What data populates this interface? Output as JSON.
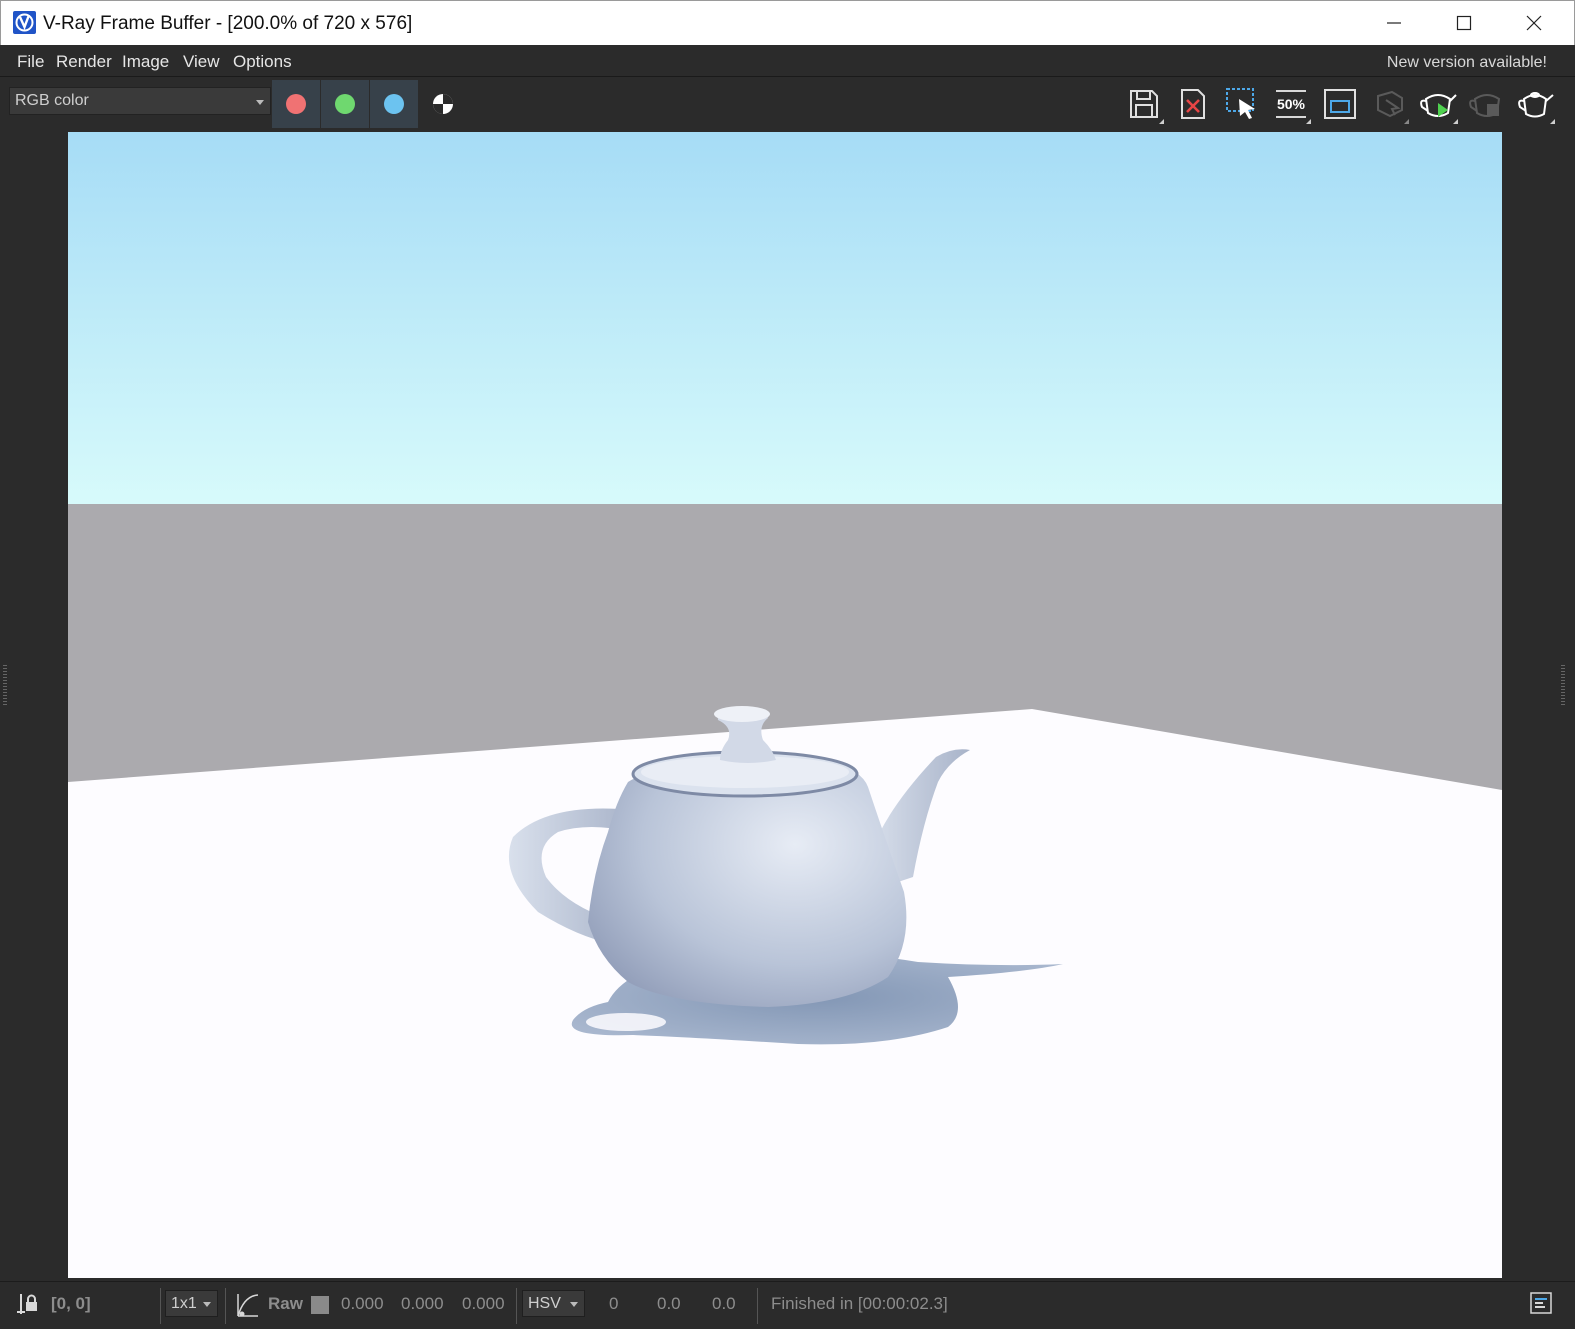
{
  "window": {
    "title": "V-Ray Frame Buffer - [200.0% of 720 x 576]",
    "controls": [
      "minimize",
      "maximize",
      "close"
    ]
  },
  "menu": {
    "items": [
      "File",
      "Render",
      "Image",
      "View",
      "Options"
    ],
    "notice": "New version available!"
  },
  "toolbar": {
    "channel": "RGB color",
    "channel_buttons": [
      {
        "name": "red-channel",
        "color": "#f07273"
      },
      {
        "name": "green-channel",
        "color": "#6fd86f"
      },
      {
        "name": "blue-channel",
        "color": "#6cc3f0"
      }
    ],
    "zoom_label": "50%",
    "tools": [
      "save-icon",
      "clear-image-icon",
      "region-render-icon",
      "zoom-50-icon",
      "frame-icon",
      "track-mouse-icon",
      "start-interactive-render-icon",
      "stop-render-icon",
      "render-teapot-icon"
    ]
  },
  "render": {
    "subject": "teapot",
    "sky_top": "#a6dcf6",
    "sky_horizon": "#d8fbfb",
    "wall": "#abaaae",
    "floor": "#fdfcff",
    "shadow": "#6d85a8"
  },
  "status": {
    "coords": "[0, 0]",
    "sample_size": "1x1",
    "mode": "Raw",
    "rgb": [
      "0.000",
      "0.000",
      "0.000"
    ],
    "color_space": "HSV",
    "hsv": [
      "0",
      "0.0",
      "0.0"
    ],
    "message": "Finished in [00:00:02.3]"
  },
  "colors": {
    "panel": "#2b2b2b",
    "accent": "#2054c7"
  }
}
